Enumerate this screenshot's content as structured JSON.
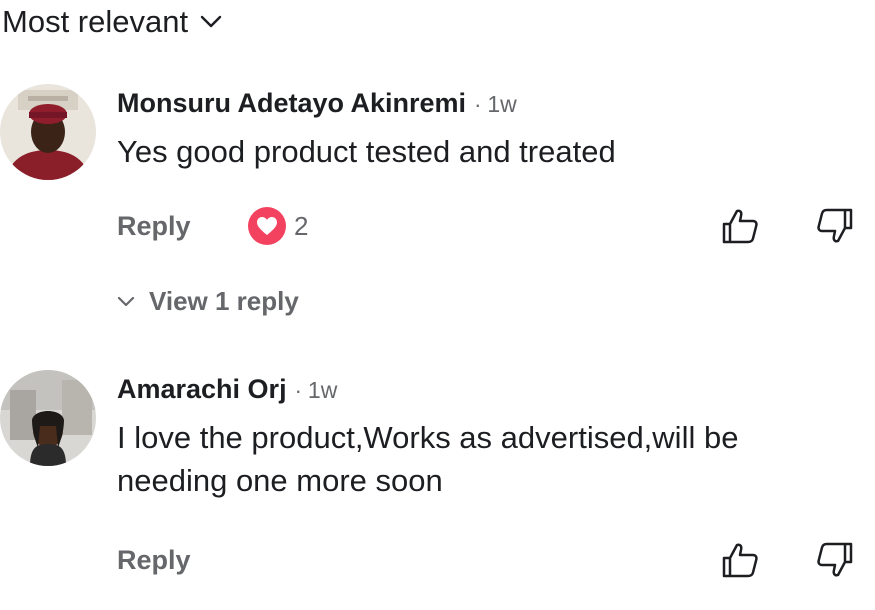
{
  "sort": {
    "label": "Most relevant"
  },
  "comments": [
    {
      "author": "Monsuru Adetayo Akinremi",
      "time": "1w",
      "text": "Yes good product tested and treated",
      "reply_label": "Reply",
      "reaction": {
        "icon": "heart-icon",
        "count": "2",
        "color": "#f3425f"
      },
      "view_replies_label": "View 1 reply"
    },
    {
      "author": "Amarachi Orj",
      "time": "1w",
      "text": "I love the product,Works as advertised,will be needing one more soon",
      "reply_label": "Reply"
    }
  ],
  "separator": "·",
  "icons": {
    "sort": "chevron-down-icon",
    "upvote": "thumbs-up-icon",
    "downvote": "thumbs-down-icon"
  }
}
